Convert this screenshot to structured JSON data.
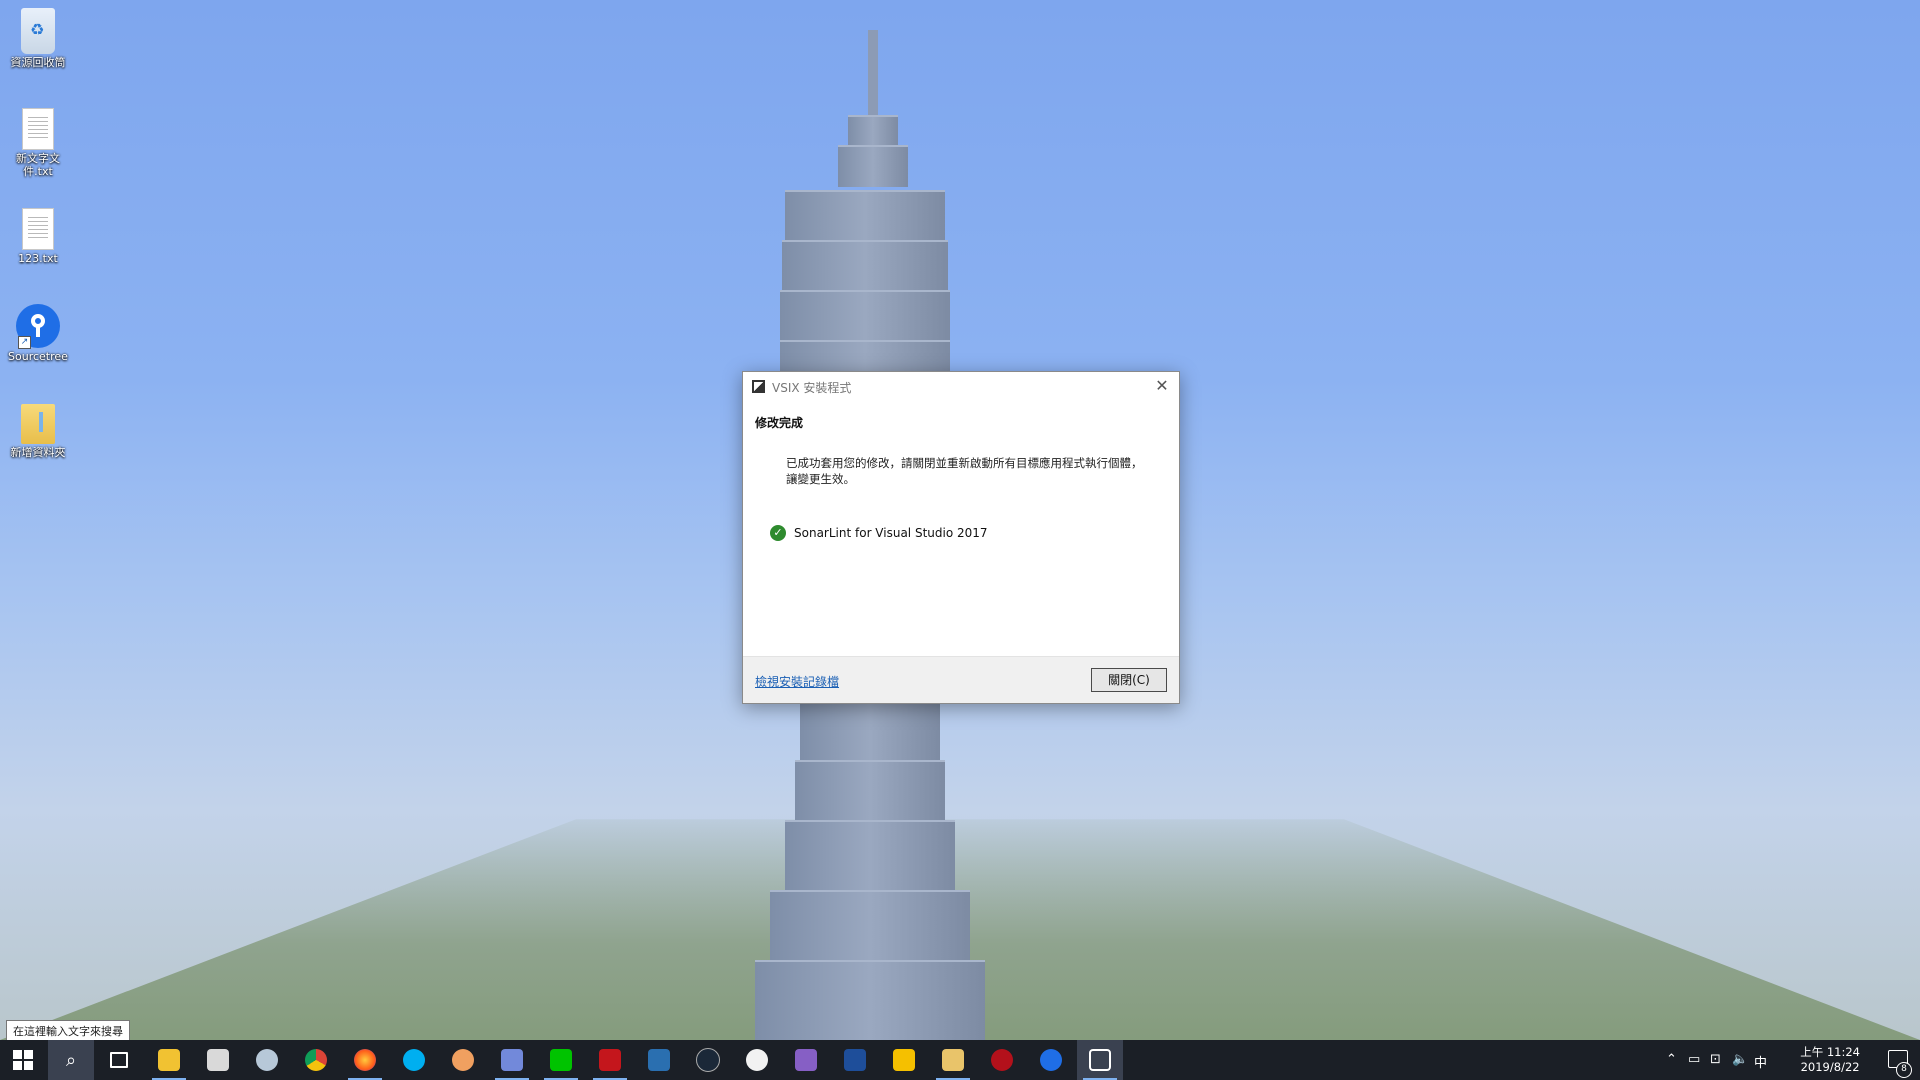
{
  "desktop": {
    "icons": [
      {
        "label": "資源回收筒",
        "icon": "recycle-bin-icon"
      },
      {
        "label": "新文字文件.txt",
        "icon": "text-file-icon"
      },
      {
        "label": "123.txt",
        "icon": "text-file-icon"
      },
      {
        "label": "Sourcetree",
        "icon": "sourcetree-icon"
      },
      {
        "label": "新增資料夾",
        "icon": "folder-icon"
      }
    ]
  },
  "dialog": {
    "title": "VSIX 安裝程式",
    "heading": "修改完成",
    "message": "已成功套用您的修改，請關閉並重新啟動所有目標應用程式執行個體，讓變更生效。",
    "item": "SonarLint for Visual Studio 2017",
    "link": "檢視安裝記錄檔",
    "close_button": "關閉(C)",
    "close_glyph": "✕"
  },
  "search_tooltip": "在這裡輸入文字來搜尋",
  "taskbar": {
    "apps": [
      "start",
      "search",
      "task-view",
      "file-explorer",
      "calculator",
      "paint",
      "chrome",
      "firefox",
      "skype",
      "app-orange",
      "discord",
      "line",
      "garena",
      "app-blue",
      "steam",
      "itunes",
      "visual-studio",
      "app-dev",
      "app-yellow",
      "app-folder",
      "app-red",
      "sourcetree",
      "vsix-installer"
    ],
    "tray": {
      "ime": "中",
      "time": "上午 11:24",
      "date": "2019/8/22",
      "notifications": "8"
    }
  },
  "colors": {
    "accent": "#1a5fb4",
    "taskbar": "#1b1f26",
    "success": "#2e8b2e"
  }
}
